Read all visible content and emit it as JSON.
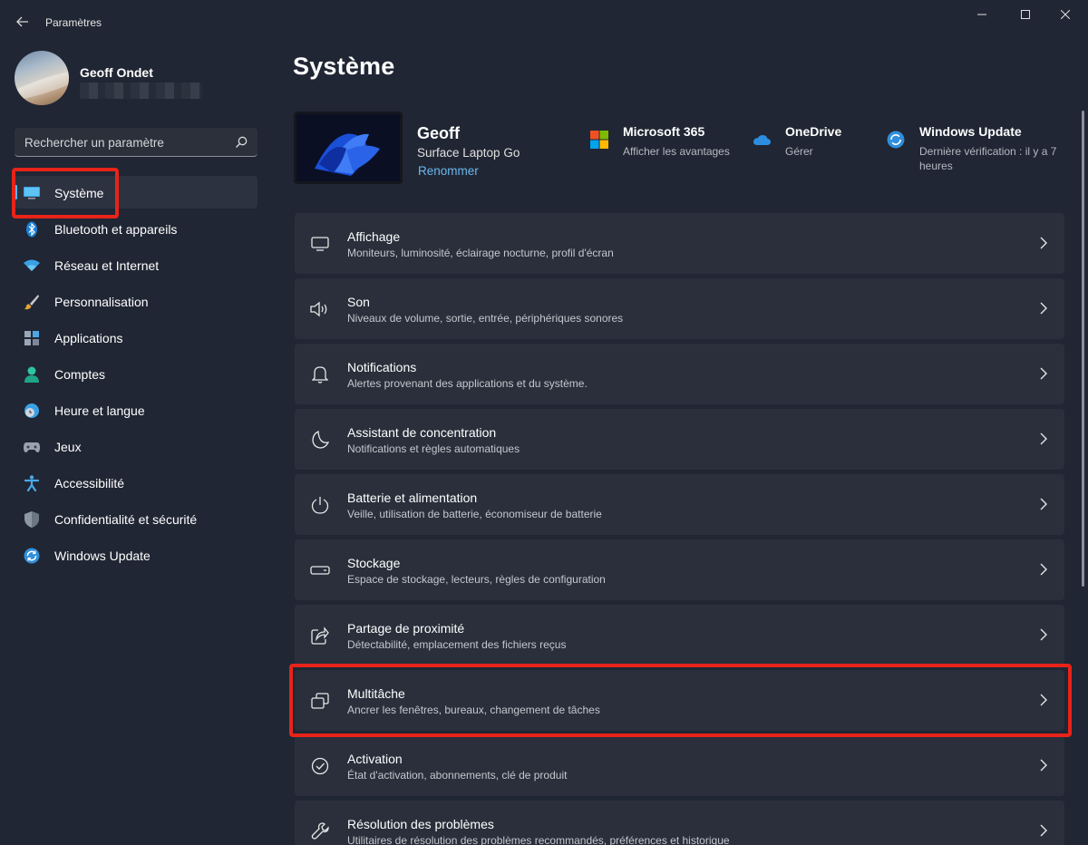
{
  "window": {
    "title": "Paramètres"
  },
  "profile": {
    "name": "Geoff Ondet"
  },
  "search": {
    "placeholder": "Rechercher un paramètre"
  },
  "sidebar": {
    "items": [
      {
        "label": "Système",
        "icon": "display-icon",
        "selected": true
      },
      {
        "label": "Bluetooth et appareils",
        "icon": "bluetooth-icon"
      },
      {
        "label": "Réseau et Internet",
        "icon": "wifi-icon"
      },
      {
        "label": "Personnalisation",
        "icon": "brush-icon"
      },
      {
        "label": "Applications",
        "icon": "apps-icon"
      },
      {
        "label": "Comptes",
        "icon": "person-icon"
      },
      {
        "label": "Heure et langue",
        "icon": "globe-clock-icon"
      },
      {
        "label": "Jeux",
        "icon": "gamepad-icon"
      },
      {
        "label": "Accessibilité",
        "icon": "accessibility-icon"
      },
      {
        "label": "Confidentialité et sécurité",
        "icon": "shield-icon"
      },
      {
        "label": "Windows Update",
        "icon": "update-icon"
      }
    ]
  },
  "main": {
    "title": "Système",
    "device": {
      "name": "Geoff",
      "model": "Surface Laptop Go",
      "rename_link": "Renommer"
    },
    "quick_links": [
      {
        "title": "Microsoft 365",
        "subtitle": "Afficher les avantages",
        "icon": "microsoft-logo-icon"
      },
      {
        "title": "OneDrive",
        "subtitle": "Gérer",
        "icon": "cloud-icon"
      },
      {
        "title": "Windows Update",
        "subtitle": "Dernière vérification : il y a 7 heures",
        "icon": "update-icon"
      }
    ],
    "settings": [
      {
        "title": "Affichage",
        "subtitle": "Moniteurs, luminosité, éclairage nocturne, profil d'écran",
        "icon": "monitor-icon"
      },
      {
        "title": "Son",
        "subtitle": "Niveaux de volume, sortie, entrée, périphériques sonores",
        "icon": "speaker-icon"
      },
      {
        "title": "Notifications",
        "subtitle": "Alertes provenant des applications et du système.",
        "icon": "bell-icon"
      },
      {
        "title": "Assistant de concentration",
        "subtitle": "Notifications et règles automatiques",
        "icon": "moon-icon"
      },
      {
        "title": "Batterie et alimentation",
        "subtitle": "Veille, utilisation de batterie, économiseur de batterie",
        "icon": "power-icon"
      },
      {
        "title": "Stockage",
        "subtitle": "Espace de stockage, lecteurs, règles de configuration",
        "icon": "drive-icon"
      },
      {
        "title": "Partage de proximité",
        "subtitle": "Détectabilité, emplacement des fichiers reçus",
        "icon": "share-icon"
      },
      {
        "title": "Multitâche",
        "subtitle": "Ancrer les fenêtres, bureaux, changement de tâches",
        "icon": "multitask-icon"
      },
      {
        "title": "Activation",
        "subtitle": "État d'activation, abonnements, clé de produit",
        "icon": "check-circle-icon"
      },
      {
        "title": "Résolution des problèmes",
        "subtitle": "Utilitaires de résolution des problèmes recommandés, préférences et historique",
        "icon": "wrench-icon"
      }
    ]
  },
  "colors": {
    "background": "#202633",
    "card": "#2a2f3b",
    "accent": "#5bb5f0",
    "highlight": "#e8231a",
    "link": "#6cb8f0"
  }
}
